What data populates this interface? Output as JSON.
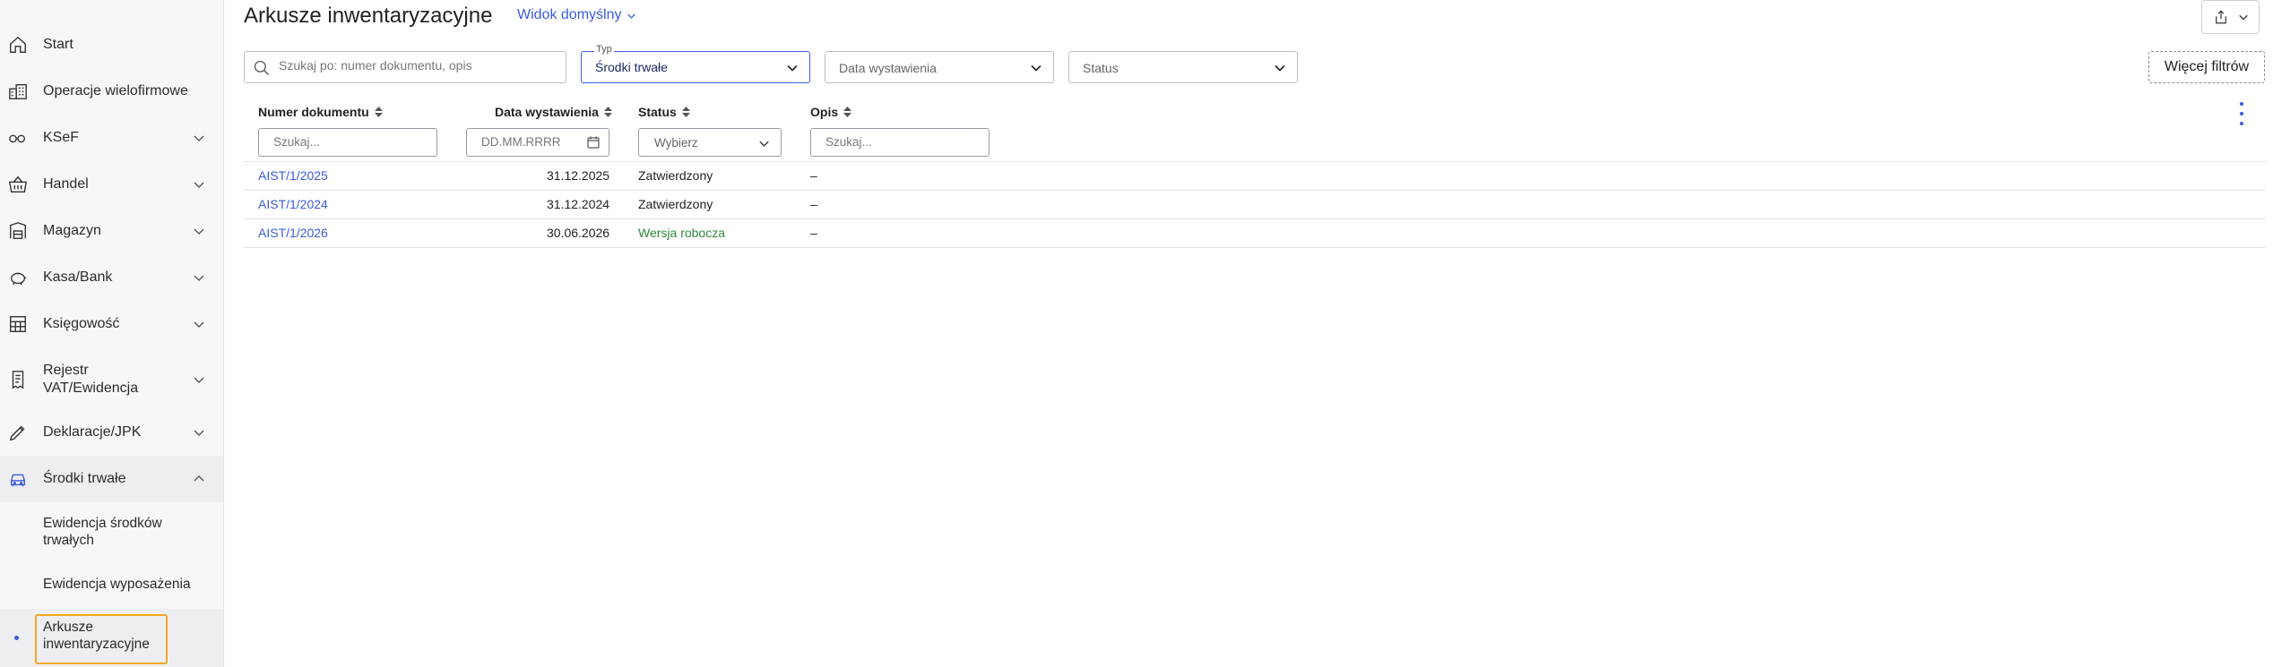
{
  "sidebar": {
    "items": [
      {
        "label": "Start",
        "icon": "home-icon"
      },
      {
        "label": "Operacje wielofirmowe",
        "icon": "buildings-icon"
      },
      {
        "label": "KSeF",
        "icon": "ksef-icon"
      },
      {
        "label": "Handel",
        "icon": "basket-icon"
      },
      {
        "label": "Magazyn",
        "icon": "warehouse-icon"
      },
      {
        "label": "Kasa/Bank",
        "icon": "piggy-bank-icon"
      },
      {
        "label": "Księgowość",
        "icon": "calculator-icon"
      },
      {
        "label": "Rejestr",
        "label2": "VAT/Ewidencja",
        "icon": "receipt-icon"
      },
      {
        "label": "Deklaracje/JPK",
        "icon": "pen-icon"
      },
      {
        "label": "Środki trwałe",
        "icon": "car-icon"
      }
    ],
    "subitems": [
      {
        "label": "Ewidencja środków",
        "label2": "trwałych"
      },
      {
        "label": "Ewidencja wyposażenia"
      },
      {
        "label": "Arkusze",
        "label2": "inwentaryzacyjne"
      }
    ]
  },
  "header": {
    "title": "Arkusze inwentaryzacyjne",
    "view": "Widok domyślny"
  },
  "filters": {
    "search_placeholder": "Szukaj po: numer dokumentu, opis",
    "type_label": "Typ",
    "type_value": "Środki trwałe",
    "date_placeholder": "Data wystawienia",
    "status_placeholder": "Status",
    "more_filters": "Więcej filtrów"
  },
  "table": {
    "columns": [
      {
        "label": "Numer dokumentu",
        "filter_placeholder": "Szukaj..."
      },
      {
        "label": "Data wystawienia",
        "filter_placeholder": "DD.MM.RRRR"
      },
      {
        "label": "Status",
        "filter_placeholder": "Wybierz"
      },
      {
        "label": "Opis",
        "filter_placeholder": "Szukaj..."
      }
    ],
    "rows": [
      {
        "number": "AIST/1/2025",
        "date": "31.12.2025",
        "status": "Zatwierdzony",
        "desc": "–"
      },
      {
        "number": "AIST/1/2024",
        "date": "31.12.2024",
        "status": "Zatwierdzony",
        "desc": "–"
      },
      {
        "number": "AIST/1/2026",
        "date": "30.06.2026",
        "status": "Wersja robocza",
        "desc": "–"
      }
    ]
  },
  "colors": {
    "accent": "#3b5bdb",
    "draft_status": "#2e8b3e",
    "highlight_border": "#f5a623"
  }
}
